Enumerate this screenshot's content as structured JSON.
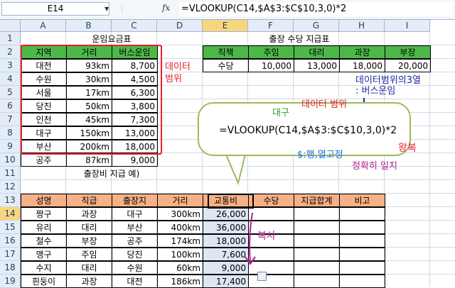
{
  "formula_bar": {
    "name_box": "E14",
    "fx": "fx",
    "formula": "=VLOOKUP(C14,$A$3:$C$10,3,0)*2"
  },
  "columns": [
    "A",
    "B",
    "C",
    "D",
    "E",
    "F",
    "G",
    "H",
    "I"
  ],
  "rows": [
    "1",
    "2",
    "3",
    "4",
    "5",
    "6",
    "7",
    "8",
    "9",
    "10",
    "11",
    "12",
    "13",
    "14",
    "15",
    "16",
    "17",
    "18",
    "19"
  ],
  "fare_table": {
    "title": "운임요금표",
    "headers": [
      "지역",
      "거리",
      "버스운임"
    ],
    "rows": [
      [
        "대전",
        "93km",
        "8,700"
      ],
      [
        "수원",
        "30km",
        "4,500"
      ],
      [
        "서울",
        "17km",
        "6,300"
      ],
      [
        "당진",
        "50km",
        "3,800"
      ],
      [
        "인천",
        "45km",
        "7,300"
      ],
      [
        "대구",
        "150km",
        "13,000"
      ],
      [
        "부산",
        "200km",
        "18,000"
      ],
      [
        "공주",
        "87km",
        "9,000"
      ]
    ]
  },
  "allowance_table": {
    "title": "출장 수당 지급표",
    "headers": [
      "직책",
      "주임",
      "대리",
      "과장",
      "부장"
    ],
    "row": [
      "수당",
      "10,000",
      "13,000",
      "18,000",
      "20,000"
    ]
  },
  "trip_table": {
    "title": "출장비 지급 예)",
    "headers": [
      "성명",
      "직급",
      "출장지",
      "거리",
      "교통비",
      "수당",
      "지급합계",
      "비고"
    ],
    "rows": [
      [
        "짱구",
        "과장",
        "대구",
        "300km",
        "26,000",
        "",
        "",
        ""
      ],
      [
        "유리",
        "대리",
        "부산",
        "400km",
        "36,000",
        "",
        "",
        ""
      ],
      [
        "철수",
        "부장",
        "공주",
        "174km",
        "18,000",
        "",
        "",
        ""
      ],
      [
        "맹구",
        "주임",
        "당진",
        "100km",
        "7,600",
        "",
        "",
        ""
      ],
      [
        "수지",
        "대리",
        "수원",
        "60km",
        "9,000",
        "",
        "",
        ""
      ],
      [
        "흰둥이",
        "과장",
        "대전",
        "186km",
        "17,400",
        "",
        "",
        ""
      ]
    ]
  },
  "bubble": {
    "formula": "=VLOOKUP(C14,$A$3:$C$10,3,0)*2"
  },
  "annotations": {
    "data_range_left": "데이터\n범위",
    "daegu": "대구",
    "data_range": "데이터 범위",
    "third_col": "데이터범위의3열\n: 버스운임",
    "round_trip": "왕복",
    "abs_ref": "$:행,열고정",
    "exact_match": "정확히 일치",
    "copy": "복사"
  },
  "colors": {
    "green_header": "#4cb848",
    "orange_header": "#f7b186",
    "highlight_blue": "#dde7f3"
  }
}
